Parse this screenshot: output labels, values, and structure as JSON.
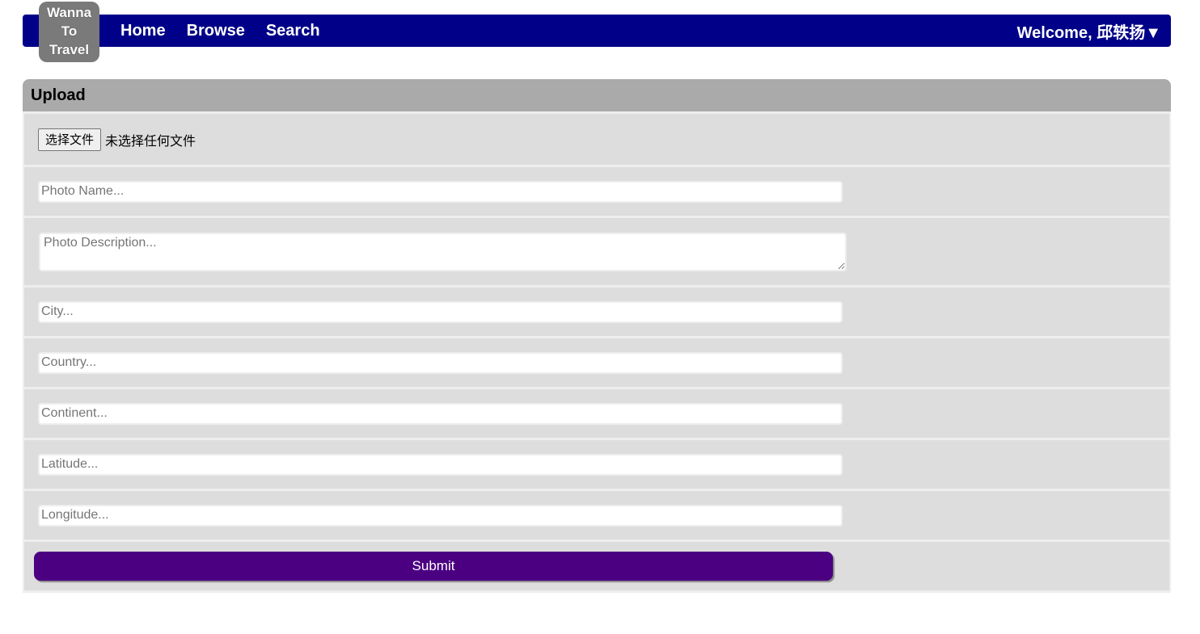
{
  "logo": {
    "line1": "Wanna",
    "line2": "To",
    "line3": "Travel"
  },
  "nav": {
    "home": "Home",
    "browse": "Browse",
    "search": "Search",
    "welcome": "Welcome, 邱轶扬▼"
  },
  "upload": {
    "title": "Upload",
    "file_button": "选择文件",
    "file_status": "未选择任何文件",
    "photo_name_placeholder": "Photo Name...",
    "photo_description_placeholder": "Photo Description...",
    "city_placeholder": "City...",
    "country_placeholder": "Country...",
    "continent_placeholder": "Continent...",
    "latitude_placeholder": "Latitude...",
    "longitude_placeholder": "Longitude...",
    "submit_label": "Submit"
  },
  "colors": {
    "navbar": "#000088",
    "panel_header": "#aaaaaa",
    "row_bg": "#dddddd",
    "submit": "#4b0082",
    "logo_bg": "#7a7a7a"
  }
}
